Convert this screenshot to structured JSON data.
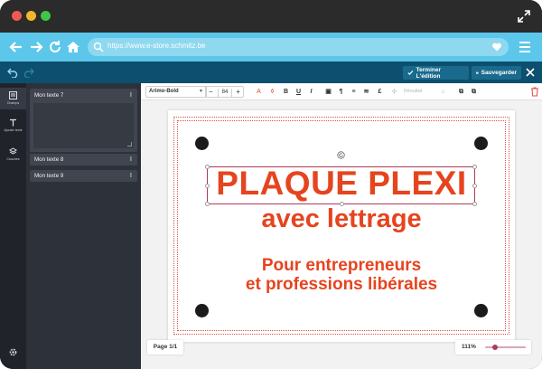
{
  "browser": {
    "url": "https://www.e-store.schmitz.be"
  },
  "app": {
    "finish_label": "Terminer L'édition",
    "save_label": "Sauvegarder"
  },
  "rail": {
    "items": [
      {
        "label": "Champs",
        "icon": "fields-icon"
      },
      {
        "label": "Ajouter texte",
        "icon": "text-icon"
      },
      {
        "label": "Couches",
        "icon": "layers-icon"
      }
    ]
  },
  "panel": {
    "texts": [
      {
        "label": "Mon texte 7"
      },
      {
        "label": "Mon texte 8"
      },
      {
        "label": "Mon texte 9"
      }
    ]
  },
  "format": {
    "font": "Arimo-Bold",
    "size": "84",
    "result_label": "Résultat"
  },
  "canvas": {
    "line1": "PLAQUE PLEXI",
    "line2": "avec lettrage",
    "line3": "Pour entrepreneurs",
    "line4": "et professions libérales",
    "text_color": "#e6441e"
  },
  "footer": {
    "page": "Page 1/1",
    "zoom": "111%",
    "zoom_fraction": 0.25
  },
  "colors": {
    "accent": "#5cc7ea",
    "app_bar": "#0c4f6e",
    "selection": "#b03a56"
  }
}
